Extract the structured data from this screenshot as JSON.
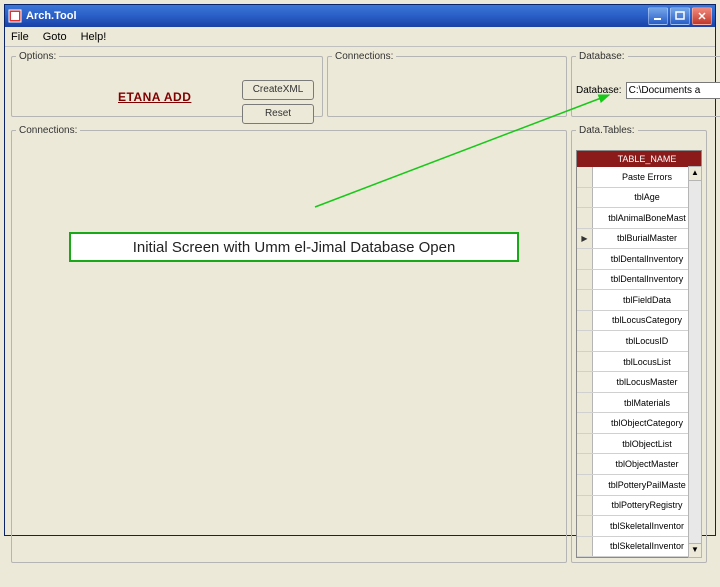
{
  "window": {
    "title": "Arch.Tool"
  },
  "menubar": {
    "file": "File",
    "goto": "Goto",
    "help": "Help!"
  },
  "groups": {
    "options": "Options:",
    "connections_top": "Connections:",
    "database": "Database:",
    "connections_big": "Connections:",
    "datatables": "Data.Tables:"
  },
  "options": {
    "link_label": "ETANA ADD",
    "btn_createxml": "CreateXML",
    "btn_reset": "Reset"
  },
  "database": {
    "label": "Database:",
    "path_value": "C:\\Documents a",
    "browse": "..."
  },
  "datatables": {
    "column_header": "TABLE_NAME",
    "selected_marker": "▶",
    "rows": [
      "Paste Errors",
      "tblAge",
      "tblAnimalBoneMast",
      "tblBurialMaster",
      "tblDentalInventory",
      "tblDentalInventory",
      "tblFieldData",
      "tblLocusCategory",
      "tblLocusID",
      "tblLocusList",
      "tblLocusMaster",
      "tblMaterials",
      "tblObjectCategory",
      "tblObjectList",
      "tblObjectMaster",
      "tblPotteryPailMaste",
      "tblPotteryRegistry",
      "tblSkeletalInventor",
      "tblSkeletalInventor"
    ]
  },
  "caption": "Initial Screen with Umm el-Jimal Database Open"
}
